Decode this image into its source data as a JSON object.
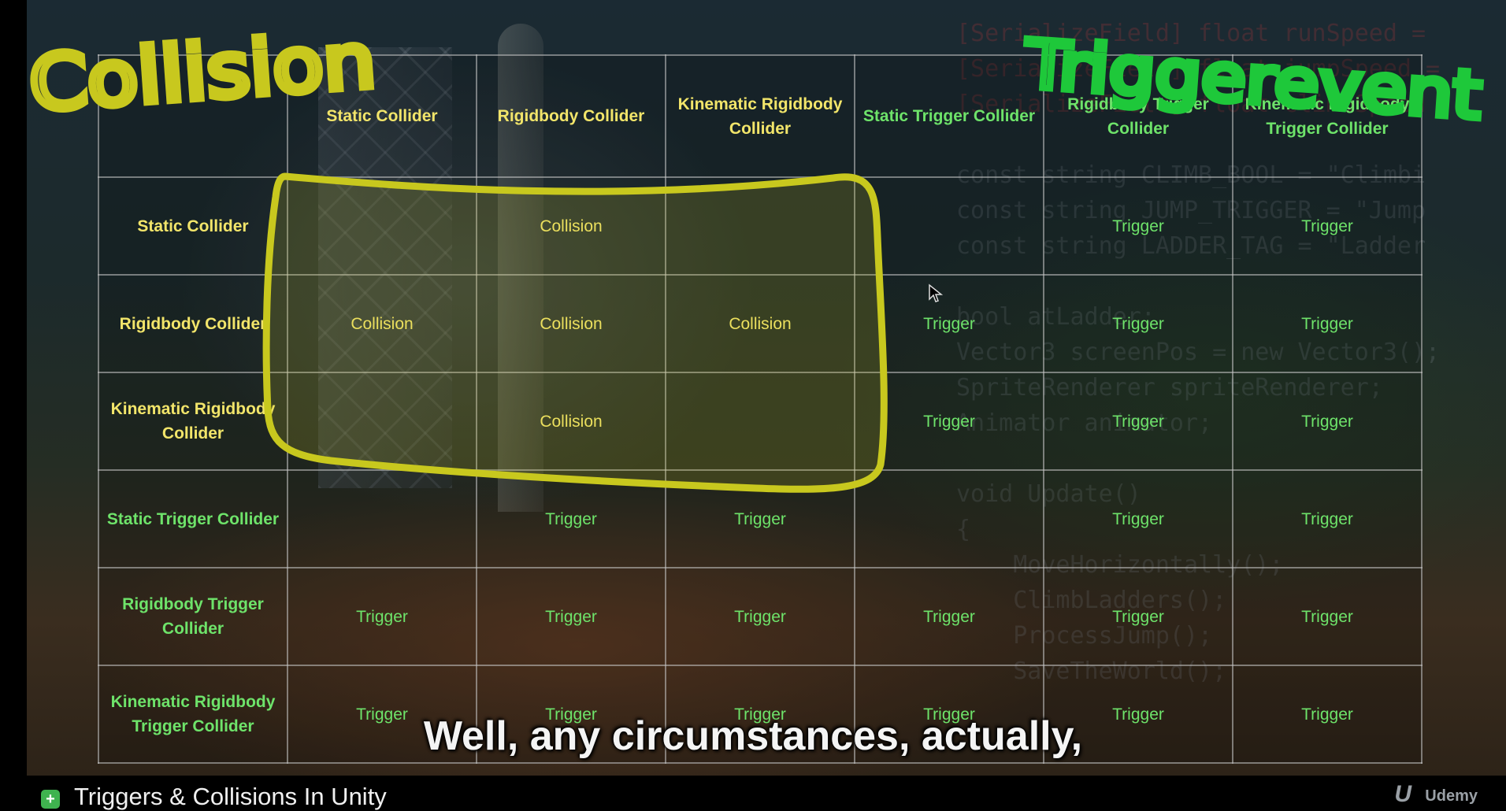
{
  "table": {
    "columns": [
      {
        "label": "Static Collider",
        "kind": "collider"
      },
      {
        "label": "Rigidbody Collider",
        "kind": "collider"
      },
      {
        "label": "Kinematic Rigidbody Collider",
        "kind": "collider"
      },
      {
        "label": "Static Trigger Collider",
        "kind": "trigger"
      },
      {
        "label": "Rigidbody Trigger Collider",
        "kind": "trigger"
      },
      {
        "label": "Kinematic Rigidbody Trigger Collider",
        "kind": "trigger"
      }
    ],
    "rows": [
      {
        "label": "Static Collider",
        "kind": "collider",
        "cells": [
          "",
          "Collision",
          "",
          "",
          "Trigger",
          "Trigger"
        ]
      },
      {
        "label": "Rigidbody Collider",
        "kind": "collider",
        "cells": [
          "Collision",
          "Collision",
          "Collision",
          "Trigger",
          "Trigger",
          "Trigger"
        ]
      },
      {
        "label": "Kinematic Rigidbody Collider",
        "kind": "collider",
        "cells": [
          "",
          "Collision",
          "",
          "Trigger",
          "Trigger",
          "Trigger"
        ]
      },
      {
        "label": "Static Trigger Collider",
        "kind": "trigger",
        "cells": [
          "",
          "Trigger",
          "Trigger",
          "",
          "Trigger",
          "Trigger"
        ]
      },
      {
        "label": "Rigidbody Trigger Collider",
        "kind": "trigger",
        "cells": [
          "Trigger",
          "Trigger",
          "Trigger",
          "Trigger",
          "Trigger",
          "Trigger"
        ]
      },
      {
        "label": "Kinematic Rigidbody Trigger Collider",
        "kind": "trigger",
        "cells": [
          "Trigger",
          "Trigger",
          "Trigger",
          "Trigger",
          "Trigger",
          "Trigger"
        ]
      }
    ]
  },
  "colors": {
    "collider_text": "#f2e56a",
    "trigger_text": "#6ee36a",
    "annotation_yellow": "#c8c81e",
    "annotation_green": "#1ec83a"
  },
  "annotations": {
    "left_handwritten": "Collision",
    "right_handwritten": "Triggerevent"
  },
  "background_code": [
    "[SerializeField] float runSpeed =",
    "[SerializeField] float jumpSpeed =",
    "[SerializeField] float climbSpeed",
    "",
    "const string CLIMB_BOOL = \"Climbi",
    "const string JUMP_TRIGGER = \"Jump",
    "const string LADDER_TAG = \"Ladder",
    "",
    "bool atLadder;",
    "Vector3 screenPos = new Vector3();",
    "SpriteRenderer spriteRenderer;",
    "Animator animator;",
    "",
    "void Update()",
    "{",
    "    MoveHorizontally();",
    "    ClimbLadders();",
    "    ProcessJump();",
    "    SaveTheWorld();"
  ],
  "caption": "Well, any circumstances, actually,",
  "footer": {
    "lesson_title": "Triggers & Collisions In Unity",
    "brand": "Udemy",
    "brand_mark": "U"
  },
  "icons": {
    "cursor": "mouse-pointer-icon",
    "lesson": "lesson-plus-icon"
  }
}
